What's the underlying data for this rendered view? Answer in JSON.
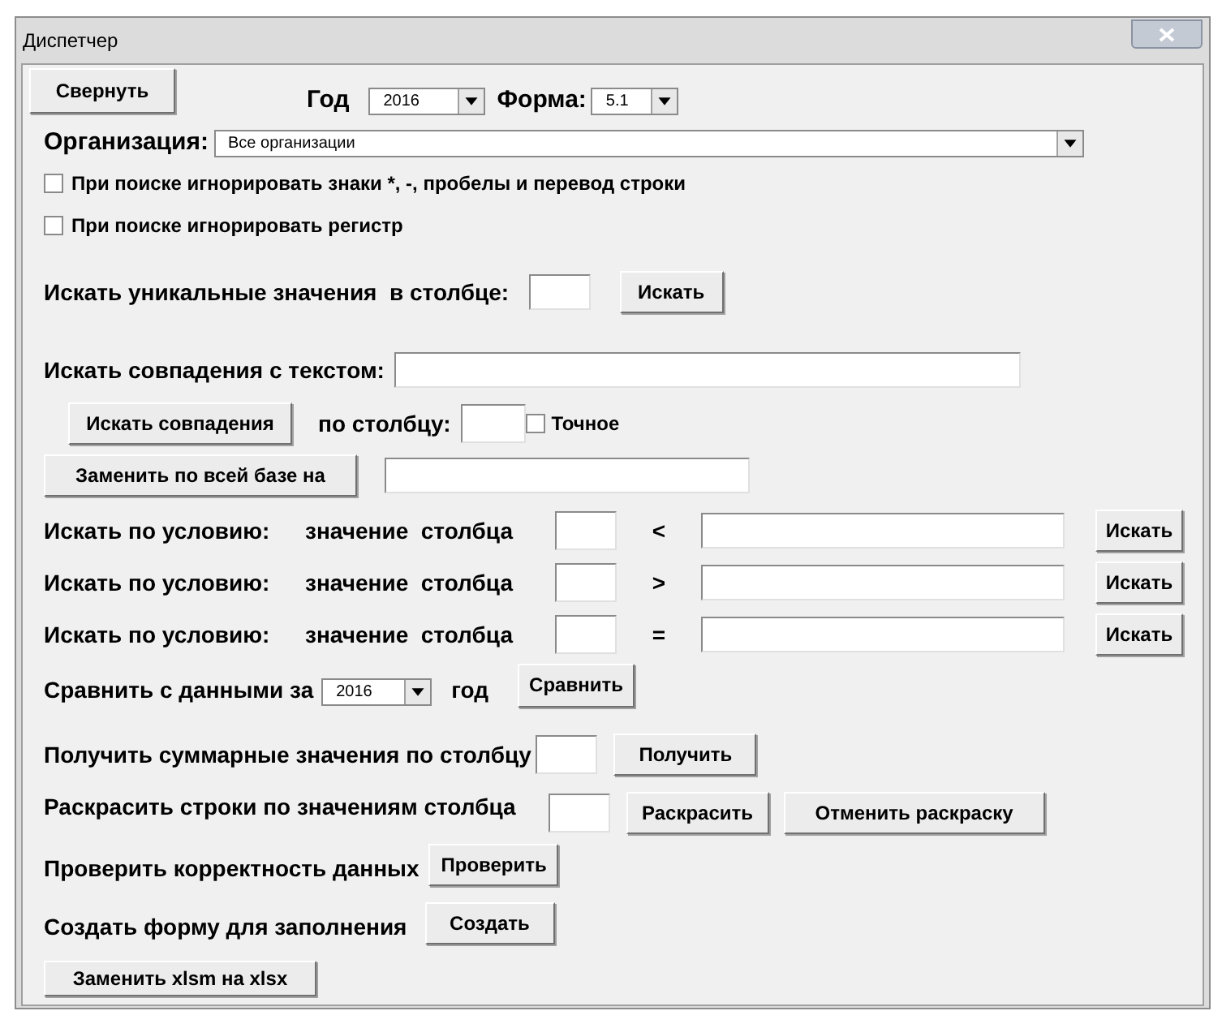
{
  "window": {
    "title": "Диспетчер"
  },
  "top": {
    "collapse_button": "Свернуть",
    "year_label": "Год",
    "year": "2016",
    "form_label": "Форма:",
    "form": "5.1"
  },
  "organization": {
    "label": "Организация:",
    "value": "Все организации"
  },
  "options": [
    {
      "label": "При поиске игнорировать знаки *, -, пробелы и перевод строки",
      "checked": false
    },
    {
      "label": "При поиске игнорировать регистр",
      "checked": false
    }
  ],
  "unique_search": {
    "label": "Искать уникальные значения  в столбце:",
    "button": "Искать"
  },
  "text_search": {
    "label": "Искать совпадения с текстом:",
    "button": "Искать совпадения",
    "column_label": "по столбцу:",
    "exact": {
      "label": "Точное",
      "checked": false
    }
  },
  "replace": {
    "button": "Заменить по всей базе на"
  },
  "conditions": [
    {
      "label": "Искать по условию:",
      "column_label": "значение  столбца",
      "operator": "<",
      "button": "Искать"
    },
    {
      "label": "Искать по условию:",
      "column_label": "значение  столбца",
      "operator": ">",
      "button": "Искать"
    },
    {
      "label": "Искать по условию:",
      "column_label": "значение  столбца",
      "operator": "=",
      "button": "Искать"
    }
  ],
  "compare": {
    "label": "Сравнить с данными за",
    "year": "2016",
    "suffix": "год",
    "button": "Сравнить"
  },
  "sum": {
    "label": "Получить суммарные значения по столбцу",
    "button": "Получить"
  },
  "colorize": {
    "label": "Раскрасить строки по значениям столбца",
    "button": "Раскрасить",
    "cancel_button": "Отменить раскраску"
  },
  "check": {
    "label": "Проверить корректность данных",
    "button": "Проверить"
  },
  "create": {
    "label": "Создать форму для заполнения",
    "button": "Создать"
  },
  "convert_button": "Заменить xlsm на xlsx"
}
